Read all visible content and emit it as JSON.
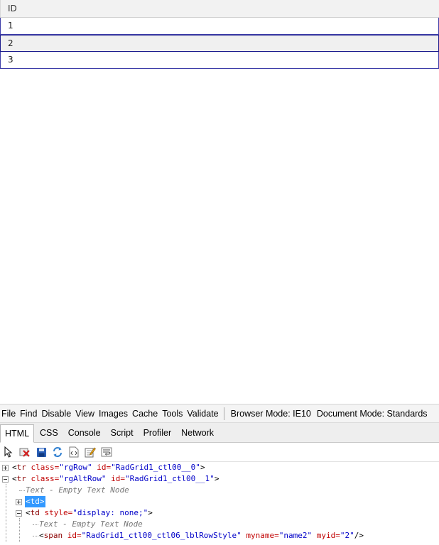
{
  "grid": {
    "column_header": "ID",
    "rows": [
      "1",
      "2",
      "3"
    ],
    "selected_row": "2"
  },
  "devtools": {
    "menu": [
      "File",
      "Find",
      "Disable",
      "View",
      "Images",
      "Cache",
      "Tools",
      "Validate"
    ],
    "browser_mode": "Browser Mode: IE10",
    "document_mode": "Document Mode: Standards",
    "tabs": [
      "HTML",
      "CSS",
      "Console",
      "Script",
      "Profiler",
      "Network"
    ],
    "active_tab": "HTML",
    "toolbar_icons": [
      "select-element-icon",
      "clear-highlight-icon",
      "save-icon",
      "refresh-icon",
      "view-source-icon",
      "edit-icon",
      "word-wrap-icon"
    ],
    "tree": {
      "line1": {
        "open": "<",
        "tag": "tr",
        "attr1": " class=",
        "val1": "\"rgRow\"",
        "attr2": " id=",
        "val2": "\"RadGrid1_ctl00__0\"",
        "close": ">"
      },
      "line2": {
        "open": "<",
        "tag": "tr",
        "attr1": " class=",
        "val1": "\"rgAltRow\"",
        "attr2": " id=",
        "val2": "\"RadGrid1_ctl00__1\"",
        "close": ">"
      },
      "line3": "Text - Empty Text Node",
      "line4": "<td>",
      "line5": {
        "open": "<",
        "tag": "td",
        "attr1": " style=",
        "val1": "\"display: none;\"",
        "close": ">"
      },
      "line6": "Text - Empty Text Node",
      "line7": {
        "open": "<",
        "tag": "span",
        "attr1": " id=",
        "val1": "\"RadGrid1_ctl00_ctl06_lblRowStyle\"",
        "attr2": " myname=",
        "val2": "\"name2\"",
        "attr3": " myid=",
        "val3": "\"2\"",
        "close": "/>"
      }
    },
    "colors": {
      "tag": "#8b0000",
      "attribute": "#c00000",
      "value": "#0000c8",
      "selection": "#3399ff"
    }
  }
}
